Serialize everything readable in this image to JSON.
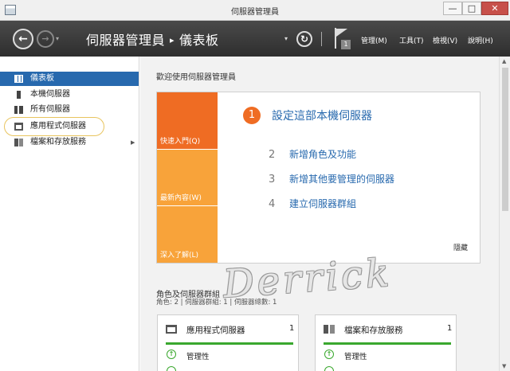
{
  "window": {
    "title": "伺服器管理員",
    "minimize": "—",
    "maximize": "□",
    "close": "✕"
  },
  "header": {
    "back": "←",
    "forward": "→",
    "breadcrumb_app": "伺服器管理員",
    "breadcrumb_sep": "▸",
    "breadcrumb_page": "儀表板",
    "refresh": "↻",
    "notification_count": "1",
    "menus": [
      "管理(M)",
      "工具(T)",
      "檢視(V)",
      "說明(H)"
    ]
  },
  "sidebar": {
    "items": [
      {
        "label": "儀表板",
        "icon": "dashboard-icon",
        "active": true
      },
      {
        "label": "本機伺服器",
        "icon": "server-icon"
      },
      {
        "label": "所有伺服器",
        "icon": "servers-icon"
      },
      {
        "label": "應用程式伺服器",
        "icon": "app-server-icon"
      },
      {
        "label": "檔案和存放服務",
        "icon": "storage-icon",
        "has_submenu": true
      }
    ]
  },
  "welcome": {
    "title": "歡迎使用伺服器管理員",
    "tiles": [
      "快速入門(Q)",
      "最新內容(W)",
      "深入了解(L)"
    ],
    "steps": [
      {
        "num": "1",
        "text": "設定這部本機伺服器"
      },
      {
        "num": "2",
        "text": "新增角色及功能"
      },
      {
        "num": "3",
        "text": "新增其他要管理的伺服器"
      },
      {
        "num": "4",
        "text": "建立伺服器群組"
      }
    ],
    "hide": "隱藏"
  },
  "roles": {
    "title": "角色及伺服器群組",
    "subtitle": "角色: 2 | 伺服器群組: 1 | 伺服器總數: 1",
    "cards": [
      {
        "name": "應用程式伺服器",
        "count": "1",
        "status": "管理性"
      },
      {
        "name": "檔案和存放服務",
        "count": "1",
        "status": "管理性"
      }
    ]
  },
  "watermark": "Derrick",
  "colors": {
    "accent": "#2769ae",
    "orange": "#ef6c23",
    "light_orange": "#f8a33a",
    "ok_green": "#3aa82e"
  }
}
